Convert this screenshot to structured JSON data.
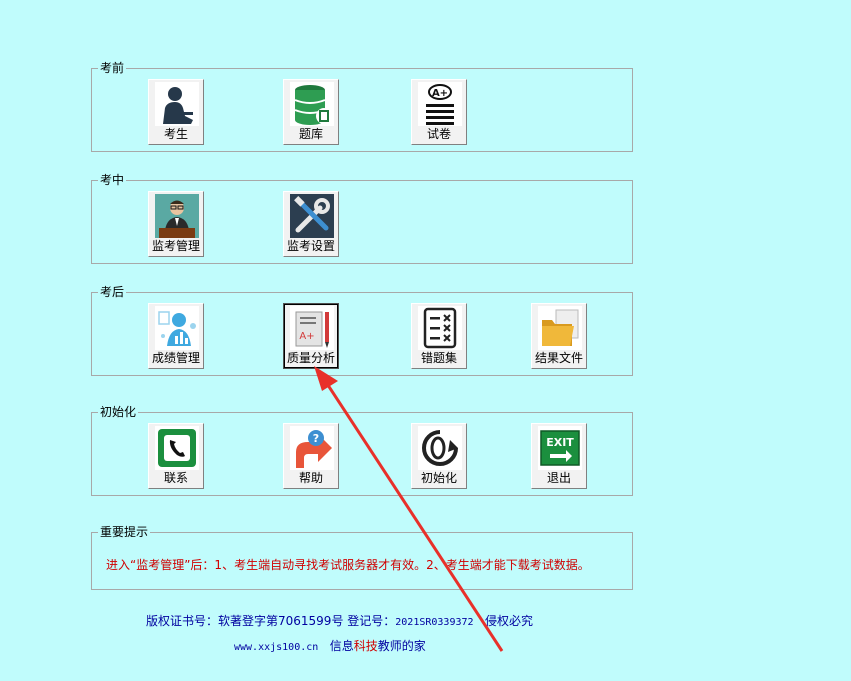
{
  "groups": [
    {
      "title": "考前",
      "buttons": [
        {
          "label": "考生",
          "icon": "student-icon"
        },
        {
          "label": "题库",
          "icon": "database-icon"
        },
        {
          "label": "试卷",
          "icon": "exam-paper-icon"
        }
      ]
    },
    {
      "title": "考中",
      "buttons": [
        {
          "label": "监考管理",
          "icon": "proctor-icon"
        },
        {
          "label": "监考设置",
          "icon": "tools-icon"
        }
      ]
    },
    {
      "title": "考后",
      "buttons": [
        {
          "label": "成绩管理",
          "icon": "score-person-icon"
        },
        {
          "label": "质量分析",
          "icon": "quality-analysis-icon"
        },
        {
          "label": "错题集",
          "icon": "wrong-list-icon"
        },
        {
          "label": "结果文件",
          "icon": "folder-icon"
        }
      ]
    },
    {
      "title": "初始化",
      "buttons": [
        {
          "label": "联系",
          "icon": "phone-icon"
        },
        {
          "label": "帮助",
          "icon": "help-icon"
        },
        {
          "label": "初始化",
          "icon": "reset-icon"
        },
        {
          "label": "退出",
          "icon": "exit-icon"
        }
      ]
    },
    {
      "title": "重要提示"
    }
  ],
  "notice": "进入“监考管理”后：1、考生端自动寻找考试服务器才有效。2、考生端才能下载考试数据。",
  "footer": {
    "copyright_label": "版权证书号：软著登字第7061599号 登记号：",
    "reg_no": "2021SR0339372",
    "rights": "侵权必究",
    "url": "www.xxjs100.cn",
    "site_pre": "信息",
    "site_mid": "科技",
    "site_post": "教师的家"
  },
  "colors": {
    "background": "#c0fcfc",
    "notice": "#d00000",
    "footer": "#0000a0",
    "arrow": "#e8302a"
  }
}
